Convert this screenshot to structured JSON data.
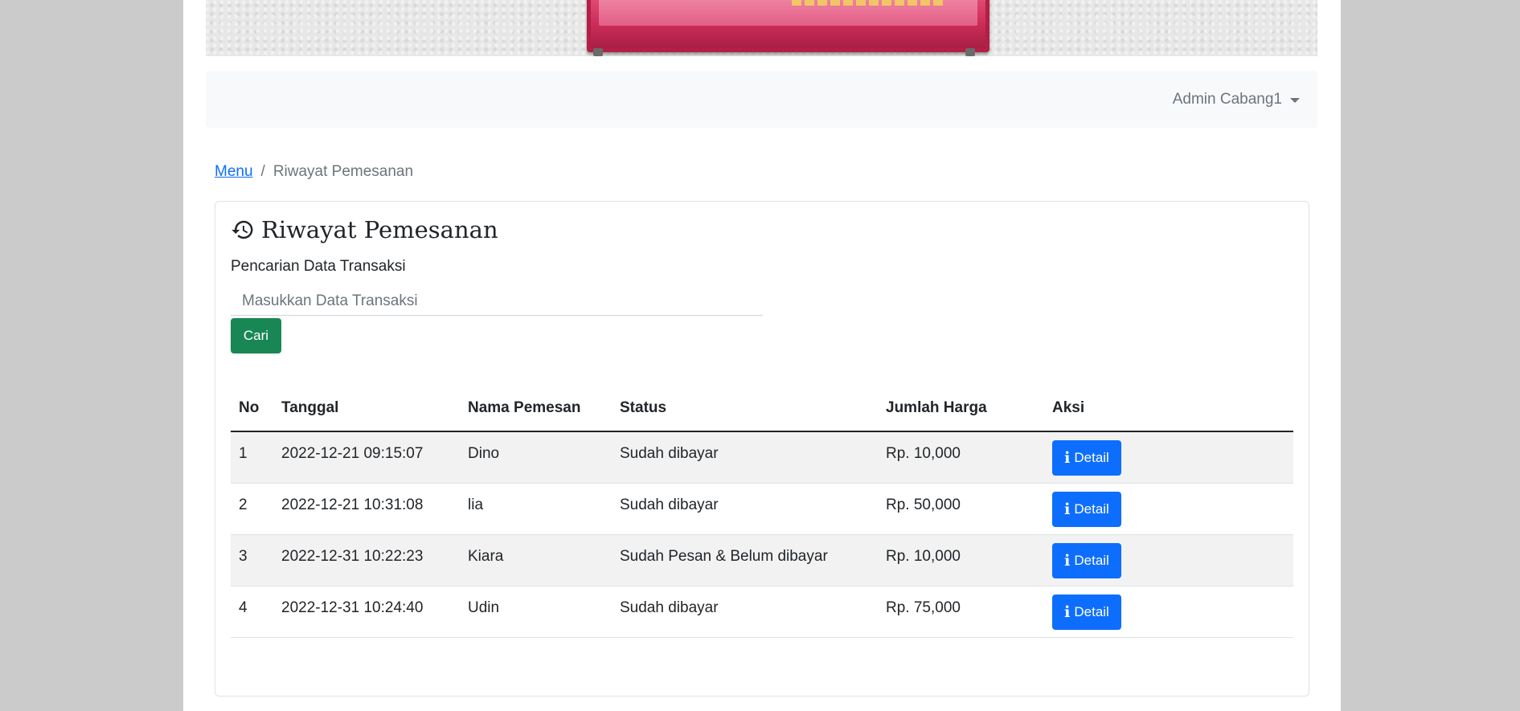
{
  "navbar": {
    "user_name": "Admin Cabang1"
  },
  "breadcrumb": {
    "home": "Menu",
    "separator": "/",
    "current": "Riwayat Pemesanan"
  },
  "card": {
    "title": "Riwayat Pemesanan",
    "title_icon": "history-icon",
    "search_label": "Pencarian Data Transaksi",
    "search_placeholder": "Masukkan Data Transaksi",
    "search_button": "Cari"
  },
  "table": {
    "headers": [
      "No",
      "Tanggal",
      "Nama Pemesan",
      "Status",
      "Jumlah Harga",
      "Aksi"
    ],
    "rows": [
      {
        "no": "1",
        "tanggal": "2022-12-21 09:15:07",
        "nama": "Dino",
        "status": "Sudah dibayar",
        "harga": "Rp. 10,000",
        "aksi": "Detail"
      },
      {
        "no": "2",
        "tanggal": "2022-12-21 10:31:08",
        "nama": "lia",
        "status": "Sudah dibayar",
        "harga": "Rp. 50,000",
        "aksi": "Detail"
      },
      {
        "no": "3",
        "tanggal": "2022-12-31 10:22:23",
        "nama": "Kiara",
        "status": "Sudah Pesan & Belum dibayar",
        "harga": "Rp. 10,000",
        "aksi": "Detail"
      },
      {
        "no": "4",
        "tanggal": "2022-12-31 10:24:40",
        "nama": "Udin",
        "status": "Sudah dibayar",
        "harga": "Rp. 75,000",
        "aksi": "Detail"
      }
    ]
  },
  "colors": {
    "primary": "#0d6efd",
    "success": "#198754",
    "navbar_bg": "#f8f9fa",
    "outer_bg": "#cbcbcb"
  }
}
